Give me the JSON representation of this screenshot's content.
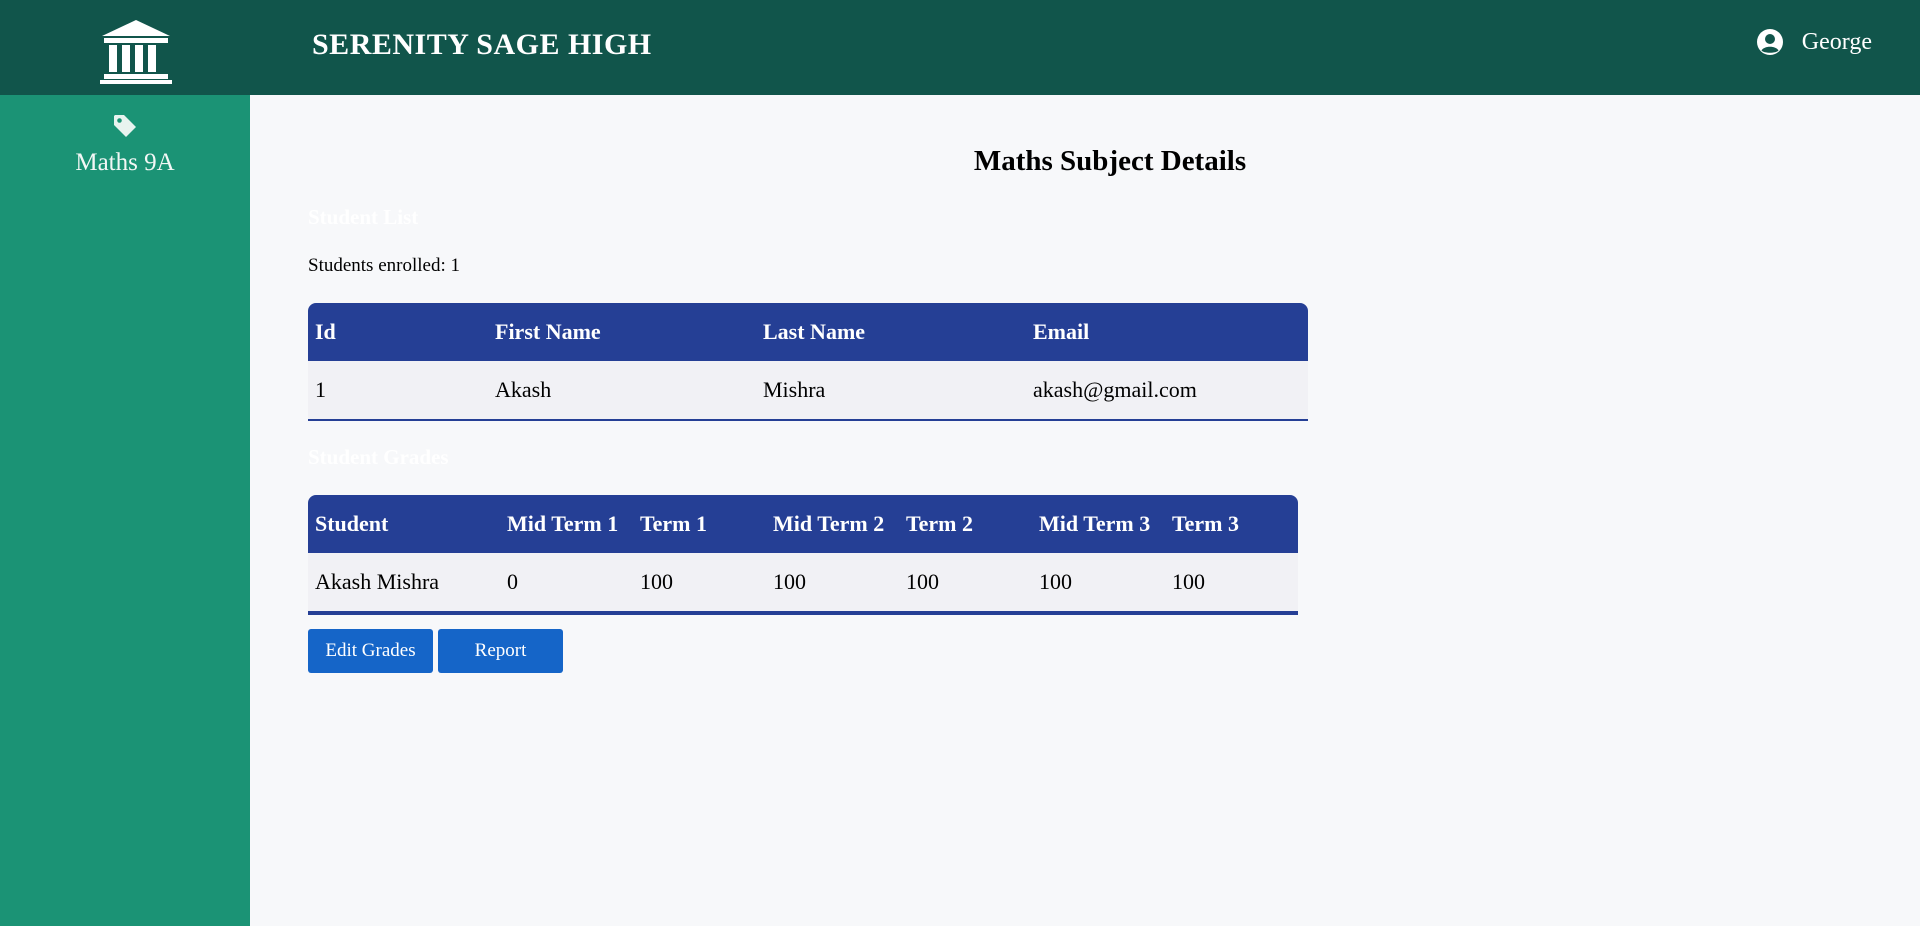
{
  "header": {
    "school_name": "SERENITY SAGE HIGH",
    "user_name": "George",
    "logo_icon": "building-columns-icon",
    "user_icon": "user-circle-icon",
    "background_color": "#11554b"
  },
  "sidebar": {
    "background_color": "#1b9375",
    "items": [
      {
        "label": "Maths 9A",
        "icon": "tag-icon"
      }
    ]
  },
  "main": {
    "title": "Maths Subject Details",
    "student_list": {
      "heading": "Student List",
      "enrolled_text": "Students enrolled: 1",
      "columns": [
        "Id",
        "First Name",
        "Last Name",
        "Email"
      ],
      "rows": [
        [
          "1",
          "Akash",
          "Mishra",
          "akash@gmail.com"
        ]
      ]
    },
    "grades": {
      "heading": "Student Grades",
      "columns": [
        "Student",
        "Mid Term 1",
        "Term 1",
        "Mid Term 2",
        "Term 2",
        "Mid Term 3",
        "Term 3"
      ],
      "rows": [
        [
          "Akash Mishra",
          "0",
          "100",
          "100",
          "100",
          "100",
          "100"
        ]
      ]
    },
    "buttons": {
      "edit_grades": "Edit Grades",
      "report": "Report"
    }
  },
  "colors": {
    "table_header": "#253f95",
    "button": "#1565c8"
  }
}
